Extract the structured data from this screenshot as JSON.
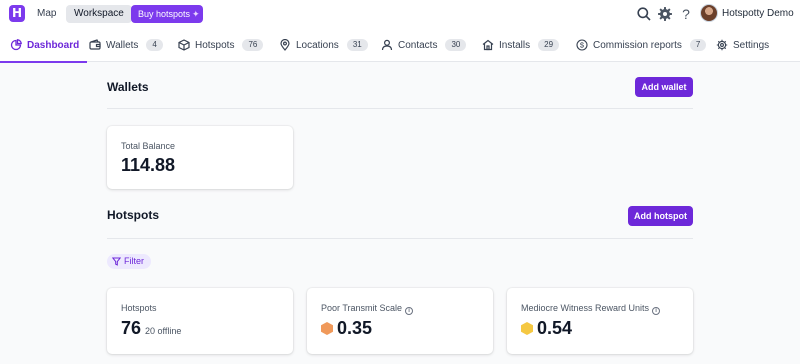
{
  "topbar": {
    "logo_letter": "H",
    "nav_map": "Map",
    "nav_workspace": "Workspace",
    "buy_button": "Buy hotspots",
    "buy_button_icon": "sparkle-icon",
    "icons": [
      "search-icon",
      "gear-icon",
      "help-icon"
    ],
    "user_name": "Hotspotty Demo"
  },
  "tabs": [
    {
      "label": "Dashboard",
      "icon": "dashboard-icon",
      "count": null,
      "active": true
    },
    {
      "label": "Wallets",
      "icon": "wallet-icon",
      "count": "4"
    },
    {
      "label": "Hotspots",
      "icon": "cube-icon",
      "count": "76"
    },
    {
      "label": "Locations",
      "icon": "map-pin-icon",
      "count": "31"
    },
    {
      "label": "Contacts",
      "icon": "user-icon",
      "count": "30"
    },
    {
      "label": "Installs",
      "icon": "home-icon",
      "count": "29"
    },
    {
      "label": "Commission reports",
      "icon": "dollar-icon",
      "count": "7"
    },
    {
      "label": "Settings",
      "icon": "settings-icon",
      "count": null
    }
  ],
  "wallets_section": {
    "title": "Wallets",
    "add_button": "Add wallet",
    "total_balance_label": "Total Balance",
    "total_balance_value": "114.88"
  },
  "hotspots_section": {
    "title": "Hotspots",
    "add_button": "Add hotspot",
    "filter_label": "Filter",
    "cards": [
      {
        "label": "Hotspots",
        "value": "76",
        "sub": "20 offline"
      },
      {
        "label": "Poor Transmit Scale",
        "value": "0.35",
        "hex_color": "#f0995a"
      },
      {
        "label": "Mediocre Witness Reward Units",
        "value": "0.54",
        "hex_color": "#f5c842"
      }
    ]
  },
  "colors": {
    "accent": "#7c3aed",
    "accent_dark": "#6d28d9"
  }
}
